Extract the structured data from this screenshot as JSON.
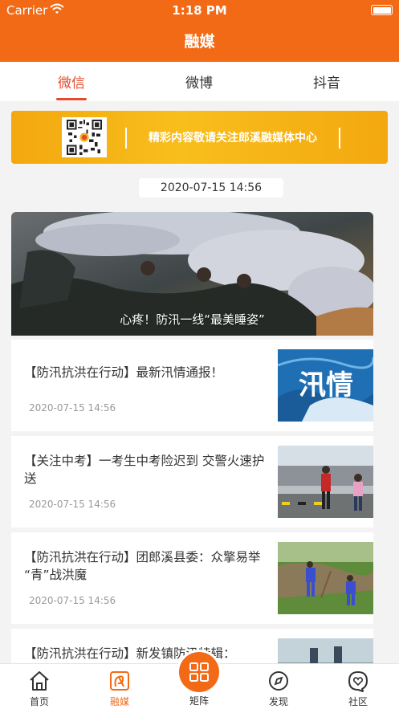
{
  "status_bar": {
    "carrier": "Carrier",
    "time": "1:18 PM"
  },
  "nav": {
    "title": "融媒"
  },
  "tabs": [
    {
      "label": "微信",
      "active": true
    },
    {
      "label": "微博",
      "active": false
    },
    {
      "label": "抖音",
      "active": false
    }
  ],
  "banner": {
    "slogan": "精彩内容敬请关注郎溪融媒体中心"
  },
  "date_header": "2020-07-15 14:56",
  "feature": {
    "caption": "心疼！防汛一线“最美睡姿”"
  },
  "news": [
    {
      "title": "【防汛抗洪在行动】最新汛情通报！",
      "time": "2020-07-15 14:56",
      "thumb_text": "汛情"
    },
    {
      "title": "【关注中考】一考生中考险迟到 交警火速护送",
      "time": "2020-07-15 14:56"
    },
    {
      "title": "【防汛抗洪在行动】团郎溪县委：众擎易举 “青”战洪魔",
      "time": "2020-07-15 14:56"
    },
    {
      "title": "【防汛抗洪在行动】新发镇防汛特辑：",
      "time": ""
    }
  ],
  "bottom_nav": {
    "home": "首页",
    "media": "融媒",
    "matrix": "矩阵",
    "discover": "发现",
    "community": "社区"
  },
  "colors": {
    "brand_orange": "#f26a16",
    "active_tab_red": "#e24a2a"
  },
  "icons": [
    "wifi-icon",
    "battery-icon",
    "qr-code-icon",
    "home-icon",
    "media-icon",
    "matrix-icon",
    "compass-icon",
    "heart-chat-icon"
  ]
}
